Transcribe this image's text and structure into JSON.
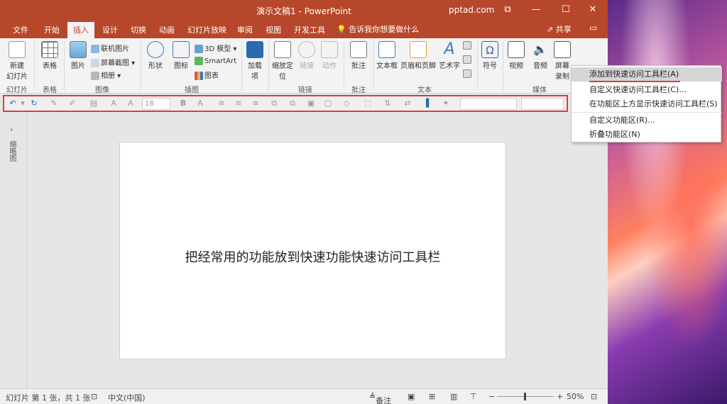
{
  "window": {
    "title": "演示文稿1 - PowerPoint",
    "account": "pptad.com",
    "min": "—",
    "restore": "⧠",
    "max": "☐",
    "close": "✕",
    "account_arrow": "_"
  },
  "tabs": [
    "文件",
    "开始",
    "插入",
    "设计",
    "切换",
    "动画",
    "幻灯片放映",
    "审阅",
    "视图",
    "开发工具"
  ],
  "active_tab": "插入",
  "tellme": "告诉我你想要做什么",
  "share": "共享",
  "ribbon": {
    "new_slide": "新建\n幻灯片",
    "new_slide_l1": "新建",
    "new_slide_l2": "幻灯片",
    "table": "表格",
    "picture": "图片",
    "online_pic": "联机图片",
    "screenshot": "屏幕截图",
    "album": "相册",
    "shapes": "形状",
    "icons": "图标",
    "model3d": "3D 模型",
    "smartart": "SmartArt",
    "chart": "图表",
    "addins_l1": "加载",
    "addins_l2": "项",
    "zoom_l1": "缩放定",
    "zoom_l2": "位",
    "link": "链接",
    "action": "动作",
    "comment": "批注",
    "textbox": "文本框",
    "header_footer": "页眉和页脚",
    "wordart": "艺术字",
    "symbol": "符号",
    "video": "视频",
    "audio": "音频",
    "screenrec_l1": "屏幕",
    "screenrec_l2": "录制",
    "groups": {
      "slides": "幻灯片",
      "tables": "表格",
      "images": "图像",
      "illustrations": "插图",
      "links": "链接",
      "comments": "批注",
      "text": "文本",
      "media": "媒体"
    }
  },
  "qat": {
    "font_size": "18"
  },
  "thumb_pane": {
    "label": "缩略图"
  },
  "slide": {
    "text": "把经常用的功能放到快速功能快速访问工具栏"
  },
  "status": {
    "slide_info": "幻灯片 第 1 张，共 1 张",
    "language": "中文(中国)",
    "notes": "备注",
    "zoom": "50%"
  },
  "context_menu": {
    "items": [
      "添加到快速访问工具栏(A)",
      "自定义快速访问工具栏(C)...",
      "在功能区上方显示快速访问工具栏(S)",
      "自定义功能区(R)...",
      "折叠功能区(N)"
    ]
  },
  "colors": {
    "accent": "#b7472a",
    "highlight": "#e23a3a"
  }
}
